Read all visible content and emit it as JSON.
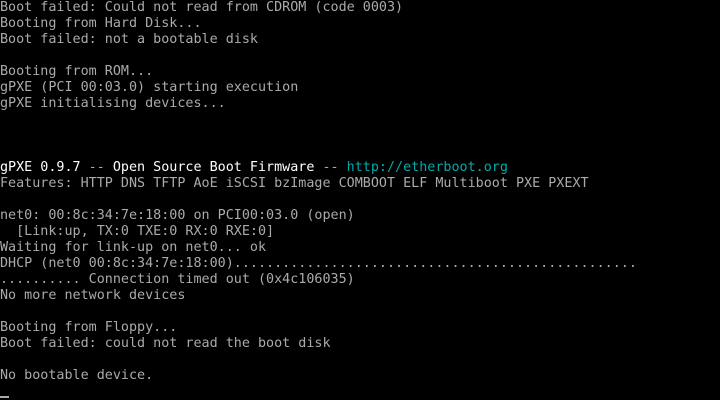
{
  "console": {
    "lines": [
      "Boot failed: Could not read from CDROM (code 0003)",
      "Booting from Hard Disk...",
      "Boot failed: not a bootable disk",
      "",
      "Booting from ROM...",
      "gPXE (PCI 00:03.0) starting execution",
      "gPXE initialising devices...",
      "",
      "",
      "",
      "",
      "Features: HTTP DNS TFTP AoE iSCSI bzImage COMBOOT ELF Multiboot PXE PXEXT",
      "",
      "net0: 00:8c:34:7e:18:00 on PCI00:03.0 (open)",
      "  [Link:up, TX:0 TXE:0 RX:0 RXE:0]",
      "Waiting for link-up on net0... ok",
      "DHCP (net0 00:8c:34:7e:18:00)..................................................",
      ".......... Connection timed out (0x4c106035)",
      "No more network devices",
      "",
      "Booting from Floppy...",
      "Boot failed: could not read the boot disk",
      "",
      "No bootable device."
    ],
    "banner": {
      "product": "gPXE 0.9.7",
      "separator_left": " -- ",
      "description": "Open Source Boot Firmware",
      "separator_right": " -- ",
      "url": "http://etherboot.org"
    }
  },
  "colors": {
    "background": "#000000",
    "text": "#aaaaaa",
    "bright": "#ffffff",
    "link": "#00aaaa"
  }
}
